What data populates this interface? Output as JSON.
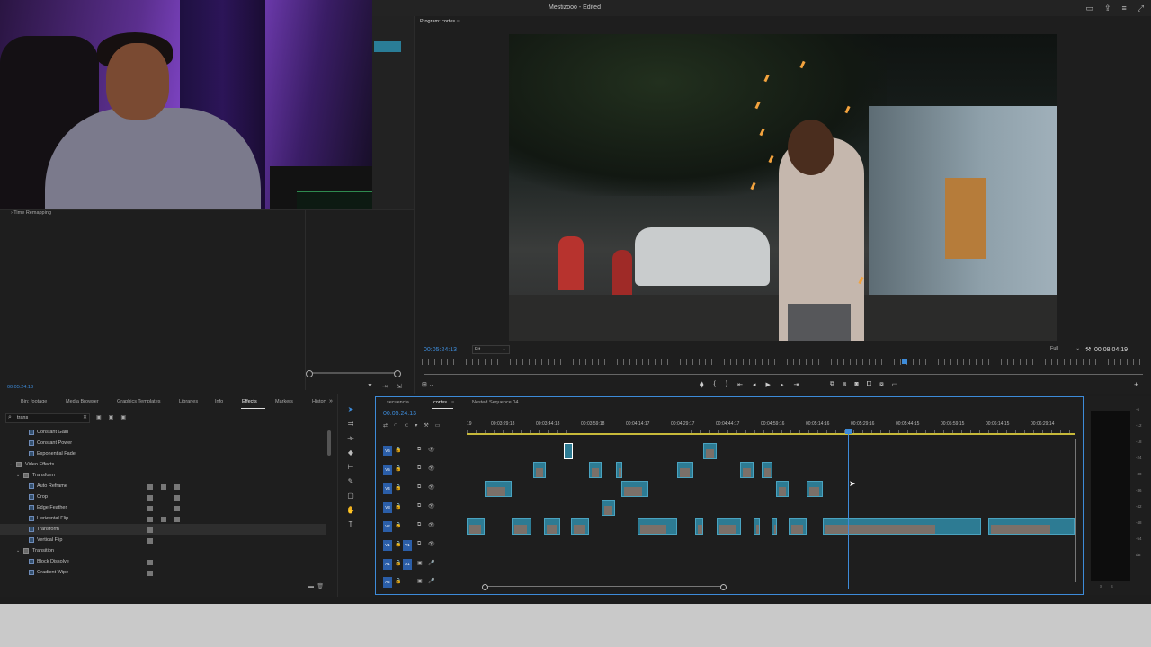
{
  "app": {
    "title": "Mestizooo - Edited"
  },
  "effect_controls": {
    "section": "Time Remapping",
    "timecode": "00:05:24:13"
  },
  "program_monitor": {
    "tab_label": "Program: cortes",
    "timecode_current": "00:05:24:13",
    "zoom": "Fit",
    "resolution": "Full",
    "timecode_duration": "00:08:04:19"
  },
  "effects_panel": {
    "tabs": [
      "Bin: footage",
      "Media Browser",
      "Graphics Templates",
      "Libraries",
      "Info",
      "Effects",
      "Markers",
      "History"
    ],
    "active_tab": "Effects",
    "search_value": "trans",
    "items": [
      {
        "label": "Constant Gain",
        "level": 2,
        "type": "effect"
      },
      {
        "label": "Constant Power",
        "level": 2,
        "type": "effect"
      },
      {
        "label": "Exponential Fade",
        "level": 2,
        "type": "effect"
      },
      {
        "label": "Video Effects",
        "level": 0,
        "type": "folder"
      },
      {
        "label": "Transform",
        "level": 1,
        "type": "folder"
      },
      {
        "label": "Auto Reframe",
        "level": 2,
        "type": "effect"
      },
      {
        "label": "Crop",
        "level": 2,
        "type": "effect"
      },
      {
        "label": "Edge Feather",
        "level": 2,
        "type": "effect"
      },
      {
        "label": "Horizontal Flip",
        "level": 2,
        "type": "effect"
      },
      {
        "label": "Transform",
        "level": 2,
        "type": "effect",
        "selected": true
      },
      {
        "label": "Vertical Flip",
        "level": 2,
        "type": "effect"
      },
      {
        "label": "Transition",
        "level": 1,
        "type": "folder"
      },
      {
        "label": "Block Dissolve",
        "level": 2,
        "type": "effect"
      },
      {
        "label": "Gradient Wipe",
        "level": 2,
        "type": "effect"
      }
    ]
  },
  "timeline": {
    "tabs": [
      "secuencia",
      "cortes",
      "Nested Sequence 04"
    ],
    "active_tab": "cortes",
    "timecode": "00:05:24:13",
    "ruler_labels": [
      "19",
      "00:03:29:18",
      "00:03:44:18",
      "00:03:59:18",
      "00:04:14:17",
      "00:04:29:17",
      "00:04:44:17",
      "00:04:59:16",
      "00:05:14:16",
      "00:05:29:16",
      "00:05:44:15",
      "00:05:59:15",
      "00:06:14:15",
      "00:06:29:14"
    ],
    "tracks": [
      {
        "name": "V6",
        "target": "V6"
      },
      {
        "name": "V5",
        "target": "V5"
      },
      {
        "name": "V4",
        "target": "V4"
      },
      {
        "name": "V3",
        "target": "V3"
      },
      {
        "name": "V2",
        "target": "V2"
      },
      {
        "name": "V1",
        "target": "V1"
      },
      {
        "name": "A1",
        "target": "A1"
      },
      {
        "name": "A2",
        "target": "A2"
      }
    ]
  },
  "audio_meter": {
    "scale": [
      "-6",
      "-12",
      "-18",
      "-24",
      "-30",
      "-36",
      "-42",
      "-48",
      "-54",
      "dB"
    ],
    "solo": [
      "S",
      "S"
    ]
  },
  "colors": {
    "accent": "#3d8bd9",
    "clip": "#2d7b93",
    "work_area": "#c7b93a"
  }
}
